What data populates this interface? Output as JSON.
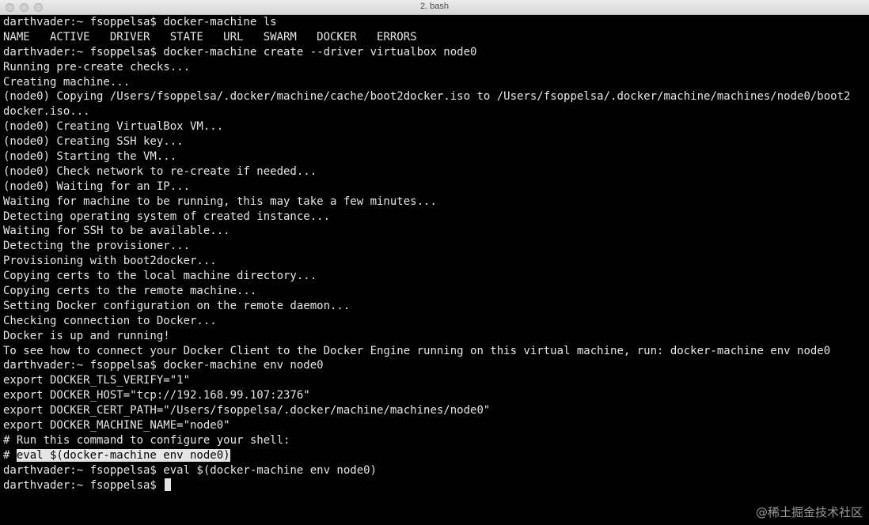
{
  "window": {
    "title": "2. bash"
  },
  "terminal": {
    "lines": [
      "darthvader:~ fsoppelsa$ docker-machine ls",
      "NAME   ACTIVE   DRIVER   STATE   URL   SWARM   DOCKER   ERRORS",
      "darthvader:~ fsoppelsa$ docker-machine create --driver virtualbox node0",
      "Running pre-create checks...",
      "Creating machine...",
      "(node0) Copying /Users/fsoppelsa/.docker/machine/cache/boot2docker.iso to /Users/fsoppelsa/.docker/machine/machines/node0/boot2",
      "docker.iso...",
      "(node0) Creating VirtualBox VM...",
      "(node0) Creating SSH key...",
      "(node0) Starting the VM...",
      "(node0) Check network to re-create if needed...",
      "(node0) Waiting for an IP...",
      "Waiting for machine to be running, this may take a few minutes...",
      "Detecting operating system of created instance...",
      "Waiting for SSH to be available...",
      "Detecting the provisioner...",
      "Provisioning with boot2docker...",
      "Copying certs to the local machine directory...",
      "Copying certs to the remote machine...",
      "Setting Docker configuration on the remote daemon...",
      "Checking connection to Docker...",
      "Docker is up and running!",
      "To see how to connect your Docker Client to the Docker Engine running on this virtual machine, run: docker-machine env node0",
      "darthvader:~ fsoppelsa$ docker-machine env node0",
      "export DOCKER_TLS_VERIFY=\"1\"",
      "export DOCKER_HOST=\"tcp://192.168.99.107:2376\"",
      "export DOCKER_CERT_PATH=\"/Users/fsoppelsa/.docker/machine/machines/node0\"",
      "export DOCKER_MACHINE_NAME=\"node0\"",
      "# Run this command to configure your shell:"
    ],
    "highlight_prefix": "# ",
    "highlight_text": "eval $(docker-machine env node0)",
    "after_lines": [
      "darthvader:~ fsoppelsa$ eval $(docker-machine env node0)"
    ],
    "prompt": "darthvader:~ fsoppelsa$ "
  },
  "watermark": "@稀土掘金技术社区",
  "colors": {
    "background": "#000000",
    "foreground": "#e6e6e6",
    "titlebar": "#e3e3e3"
  }
}
